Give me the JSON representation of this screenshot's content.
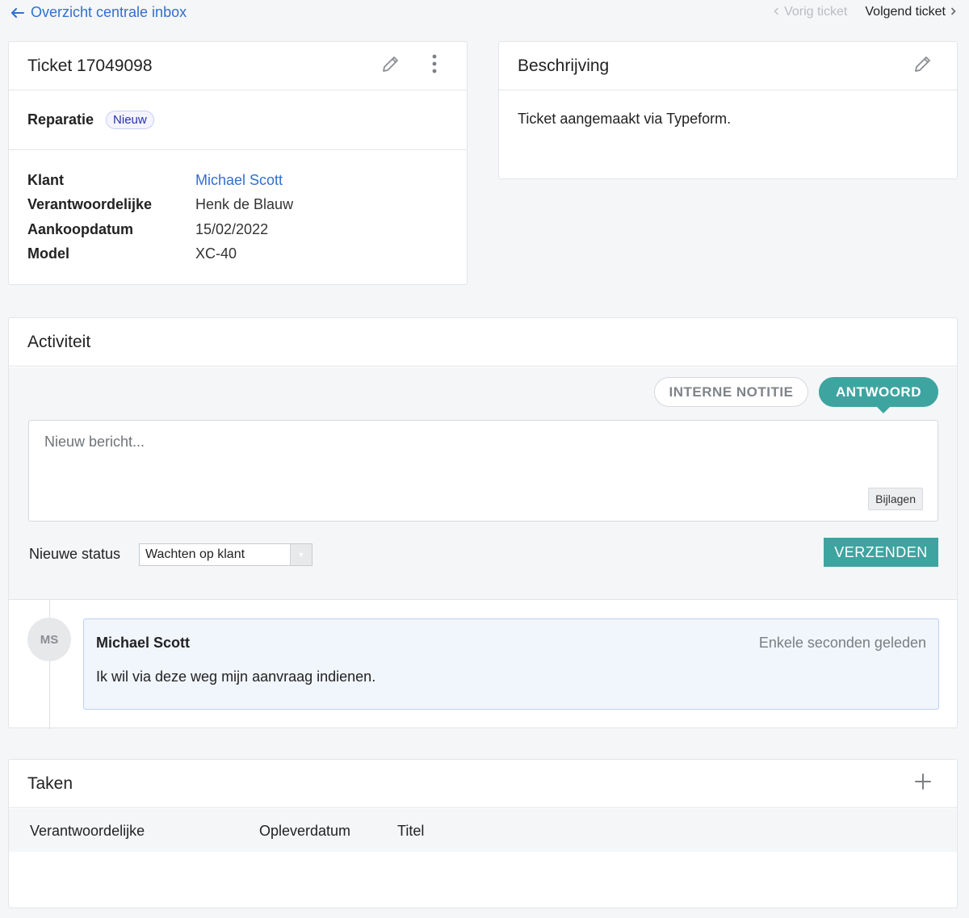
{
  "nav": {
    "back_label": "Overzicht centrale inbox",
    "prev_label": "Vorig ticket",
    "next_label": "Volgend ticket"
  },
  "ticket": {
    "title": "Ticket 17049098",
    "type": "Reparatie",
    "status_badge": "Nieuw",
    "fields": [
      {
        "key": "Klant",
        "value": "Michael Scott"
      },
      {
        "key": "Verantwoordelijke",
        "value": "Henk de Blauw"
      },
      {
        "key": "Aankoopdatum",
        "value": "15/02/2022"
      },
      {
        "key": "Model",
        "value": "XC-40"
      }
    ]
  },
  "description": {
    "title": "Beschrijving",
    "text": "Ticket aangemaakt via Typeform."
  },
  "activity": {
    "title": "Activiteit",
    "tab_internal": "INTERNE NOTITIE",
    "tab_reply": "ANTWOORD",
    "message_placeholder": "Nieuw bericht...",
    "attachments_label": "Bijlagen",
    "status_label": "Nieuwe status",
    "status_value": "Wachten op klant",
    "send_label": "VERZENDEN",
    "comment": {
      "initials": "MS",
      "author": "Michael Scott",
      "time": "Enkele seconden geleden",
      "text": "Ik wil via deze weg mijn aanvraag indienen."
    }
  },
  "tasks": {
    "title": "Taken",
    "columns": [
      "Verantwoordelijke",
      "Opleverdatum",
      "Titel"
    ]
  },
  "colors": {
    "link": "#2f6fd0",
    "accent": "#3ea4a0",
    "badge_text": "#2632a6",
    "comment_bg": "#f1f5fc"
  },
  "icons": {
    "back": "arrow-left-icon",
    "prev": "chevron-left-icon",
    "next": "chevron-right-icon",
    "edit": "pencil-icon",
    "more": "vertical-dots-icon",
    "add": "plus-icon"
  }
}
